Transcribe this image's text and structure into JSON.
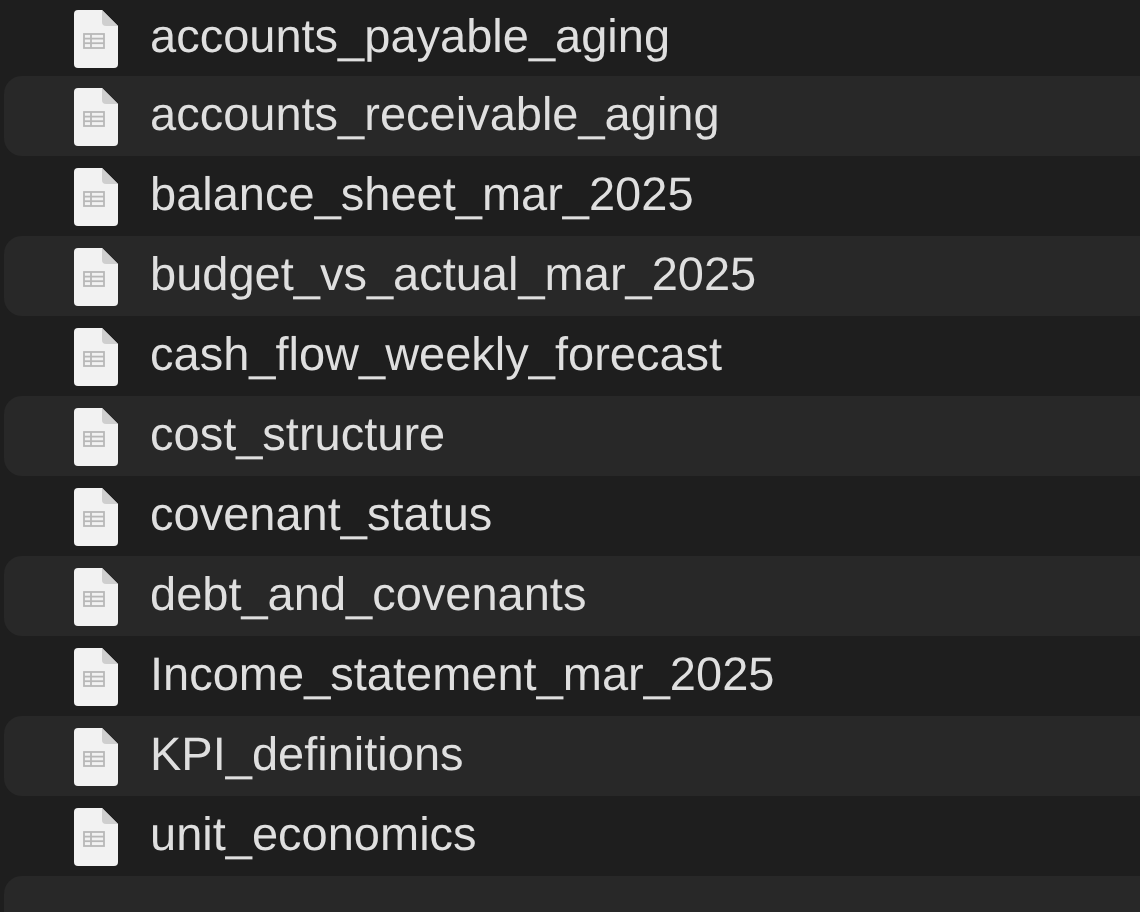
{
  "files": [
    {
      "name": "accounts_payable_aging"
    },
    {
      "name": "accounts_receivable_aging"
    },
    {
      "name": "balance_sheet_mar_2025"
    },
    {
      "name": "budget_vs_actual_mar_2025"
    },
    {
      "name": "cash_flow_weekly_forecast"
    },
    {
      "name": "cost_structure"
    },
    {
      "name": "covenant_status"
    },
    {
      "name": "debt_and_covenants"
    },
    {
      "name": "Income_statement_mar_2025"
    },
    {
      "name": "KPI_definitions"
    },
    {
      "name": "unit_economics"
    }
  ]
}
